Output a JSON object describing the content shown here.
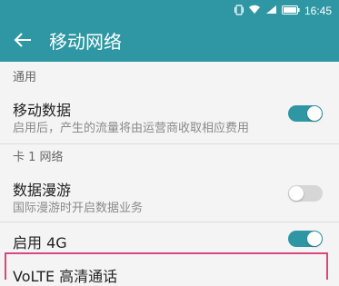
{
  "statusbar": {
    "time": "16:45"
  },
  "appbar": {
    "title": "移动网络"
  },
  "sections": {
    "general": "通用",
    "card1": "卡 1 网络"
  },
  "rows": {
    "mobile_data": {
      "title": "移动数据",
      "subtitle": "启用后，产生的流量将由运营商收取相应费用",
      "enabled": true
    },
    "roaming": {
      "title": "数据漫游",
      "subtitle": "国际漫游时开启数据业务",
      "enabled": false
    },
    "enable_4g": {
      "title": "启用 4G",
      "enabled": true
    },
    "hd_call": {
      "title": "VoLTE 高清通话"
    }
  },
  "colors": {
    "accent": "#2e97a3",
    "highlight": "#d9487d"
  },
  "icons": [
    "vibrate-icon",
    "wifi-icon",
    "signal-icon",
    "battery-icon",
    "back-arrow-icon"
  ]
}
